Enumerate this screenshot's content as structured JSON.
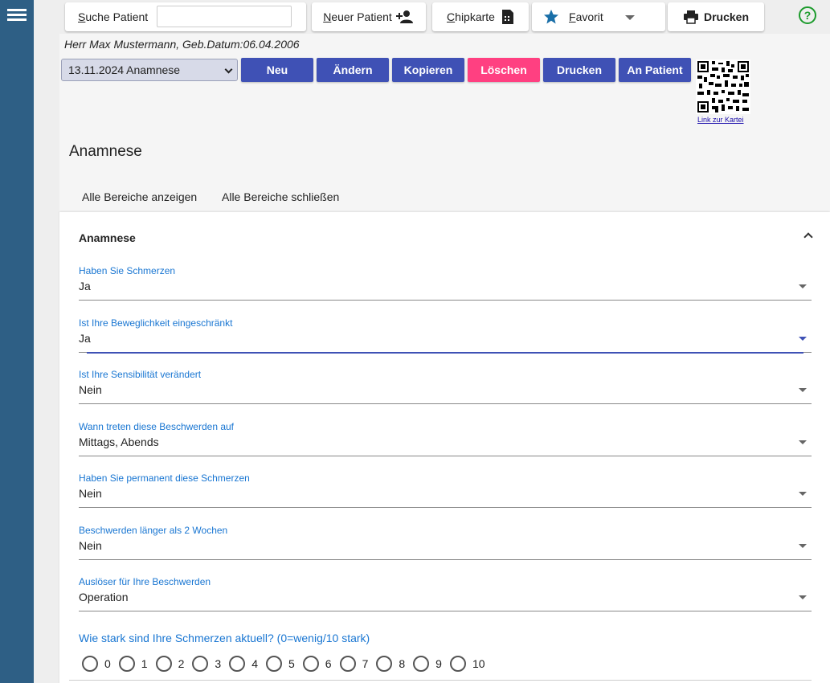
{
  "topbar": {
    "search_label": "Suche Patient",
    "search_value": "",
    "new_patient_label": "Neuer Patient",
    "chipcard_label": "Chipkarte",
    "favorite_label": "Favorit",
    "print_label": "Drucken",
    "help_symbol": "?"
  },
  "patient": {
    "line": "Herr Max Mustermann, Geb.Datum:06.04.2006"
  },
  "record": {
    "selected": "13.11.2024 Anamnese"
  },
  "actions": {
    "neu": "Neu",
    "aendern": "Ändern",
    "kopieren": "Kopieren",
    "loeschen": "Löschen",
    "drucken": "Drucken",
    "an_patient": "An Patient"
  },
  "qr": {
    "link_label": "Link zur Kartei"
  },
  "page": {
    "title": "Anamnese",
    "show_all": "Alle Bereiche anzeigen",
    "close_all": "Alle Bereiche schließen"
  },
  "panel": {
    "header": "Anamnese",
    "fields": [
      {
        "label": "Haben Sie Schmerzen",
        "value": "Ja"
      },
      {
        "label": "Ist Ihre Beweglichkeit eingeschränkt",
        "value": "Ja"
      },
      {
        "label": "Ist Ihre Sensibilität verändert",
        "value": "Nein"
      },
      {
        "label": "Wann treten diese Beschwerden auf",
        "value": "Mittags, Abends"
      },
      {
        "label": "Haben Sie permanent diese Schmerzen",
        "value": "Nein"
      },
      {
        "label": "Beschwerden länger als 2 Wochen",
        "value": "Nein"
      },
      {
        "label": "Auslöser für Ihre Beschwerden",
        "value": "Operation"
      }
    ],
    "pain_question": "Wie stark sind Ihre Schmerzen aktuell? (0=wenig/10 stark)",
    "pain_options": [
      "0",
      "1",
      "2",
      "3",
      "4",
      "5",
      "6",
      "7",
      "8",
      "9",
      "10"
    ]
  },
  "colors": {
    "sidebar": "#2e5f85",
    "primary": "#3f51b5",
    "danger": "#ff4081",
    "label_blue": "#1976d2",
    "help_green": "#1c9b2c"
  }
}
